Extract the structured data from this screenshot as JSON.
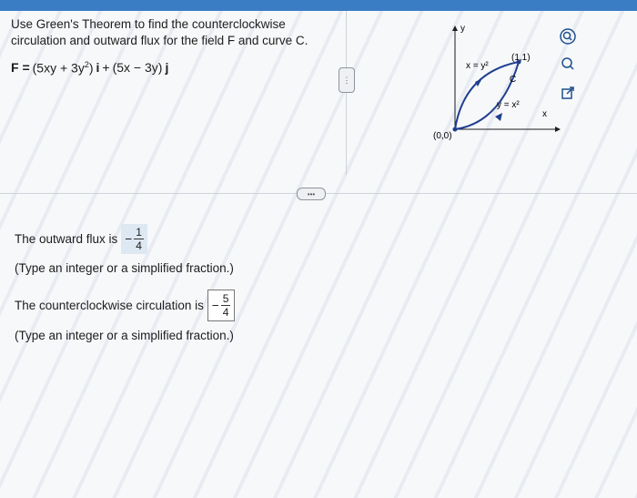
{
  "question": {
    "line1": "Use Green's Theorem to find the counterclockwise",
    "line2": "circulation and outward flux for the field F and curve C."
  },
  "formula": {
    "lhs": "F =",
    "part1": "(5xy + 3y",
    "sup": "2",
    "part1_close": ")",
    "i": "i",
    "plus": "+",
    "part2": "(5x − 3y)",
    "j": "j"
  },
  "graph": {
    "y_label": "y",
    "x_label": "x",
    "curve_top_label": "x = y²",
    "curve_bottom_label": "y = x²",
    "curve_name": "C",
    "point_label": "(1,1)",
    "origin_label": "(0,0)"
  },
  "answers": {
    "flux_label": "The outward flux is",
    "flux_sign": "−",
    "flux_num": "1",
    "flux_den": "4",
    "flux_hint": "(Type an integer or a simplified fraction.)",
    "circ_label": "The counterclockwise circulation is",
    "circ_sign": "−",
    "circ_num": "5",
    "circ_den": "4",
    "circ_hint": "(Type an integer or a simplified fraction.)"
  },
  "tools": [
    "zoom-in-icon",
    "zoom-out-icon",
    "popout-icon"
  ],
  "colors": {
    "accent": "#3b7dc4",
    "curve": "#1f3f8f"
  }
}
